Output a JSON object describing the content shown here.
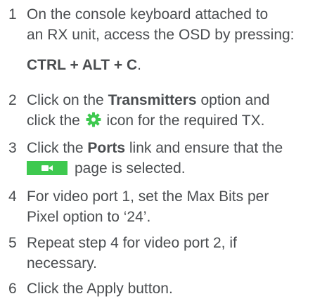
{
  "steps": [
    {
      "number": "1",
      "line1": "On the console keyboard attached to",
      "line2": "an RX unit, access the OSD by pressing:",
      "shortcut": "CTRL + ALT + C",
      "shortcut_end": "."
    },
    {
      "number": "2",
      "line1_a": "Click on the ",
      "line1_bold": "Transmitters",
      "line1_b": " option and",
      "line2_a": "click the ",
      "icon": "gear-icon",
      "line2_b": " icon for the required TX."
    },
    {
      "number": "3",
      "line1_a": "Click the ",
      "line1_bold": "Ports",
      "line1_b": " link and ensure that the",
      "icon": "video-camera-icon",
      "icon_color": "#3ec94f",
      "line2": "page is selected."
    },
    {
      "number": "4",
      "line1": "For video port 1, set the Max Bits per",
      "line2": "Pixel option to ‘24’."
    },
    {
      "number": "5",
      "line1": "Repeat step 4 for video port 2, if",
      "line2": "necessary."
    },
    {
      "number": "6",
      "line1": "Click the Apply button."
    }
  ]
}
